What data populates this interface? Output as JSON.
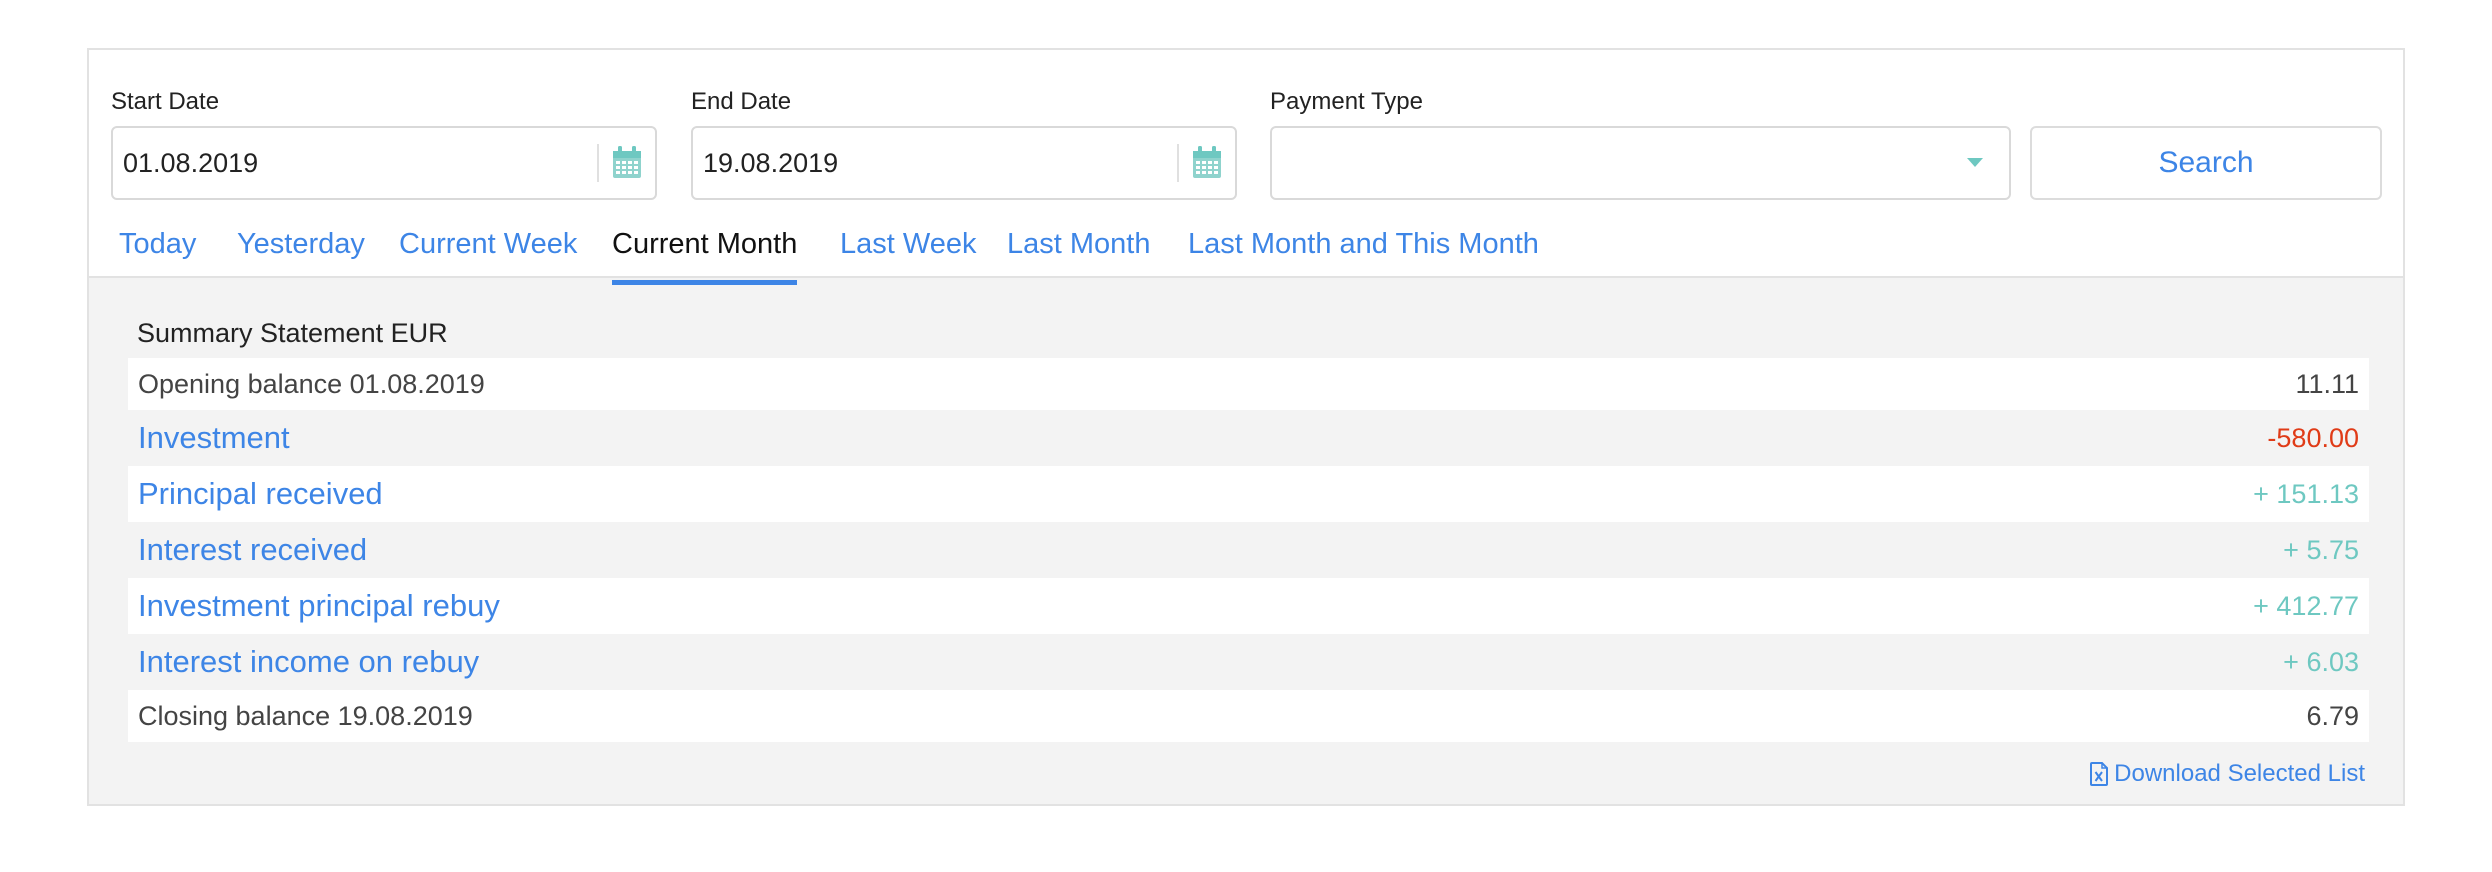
{
  "filters": {
    "start_date": {
      "label": "Start Date",
      "value": "01.08.2019"
    },
    "end_date": {
      "label": "End Date",
      "value": "19.08.2019"
    },
    "payment_type": {
      "label": "Payment Type",
      "value": ""
    },
    "search_label": "Search"
  },
  "tabs": [
    {
      "label": "Today",
      "active": false
    },
    {
      "label": "Yesterday",
      "active": false
    },
    {
      "label": "Current Week",
      "active": false
    },
    {
      "label": "Current Month",
      "active": true
    },
    {
      "label": "Last Week",
      "active": false
    },
    {
      "label": "Last Month",
      "active": false
    },
    {
      "label": "Last Month and This Month",
      "active": false
    }
  ],
  "summary": {
    "title": "Summary Statement EUR",
    "rows": [
      {
        "label": "Opening balance 01.08.2019",
        "value": "11.11",
        "type": "balance"
      },
      {
        "label": "Investment",
        "value": "-580.00",
        "type": "negative"
      },
      {
        "label": "Principal received",
        "value": "+ 151.13",
        "type": "positive"
      },
      {
        "label": "Interest received",
        "value": "+ 5.75",
        "type": "positive"
      },
      {
        "label": "Investment principal rebuy",
        "value": "+ 412.77",
        "type": "positive"
      },
      {
        "label": "Interest income on rebuy",
        "value": "+ 6.03",
        "type": "positive"
      },
      {
        "label": "Closing balance 19.08.2019",
        "value": "6.79",
        "type": "balance"
      }
    ],
    "download_label": "Download Selected List"
  },
  "colors": {
    "accent": "#3d85e6",
    "positive": "#6ec8c1",
    "negative": "#e03b17"
  }
}
